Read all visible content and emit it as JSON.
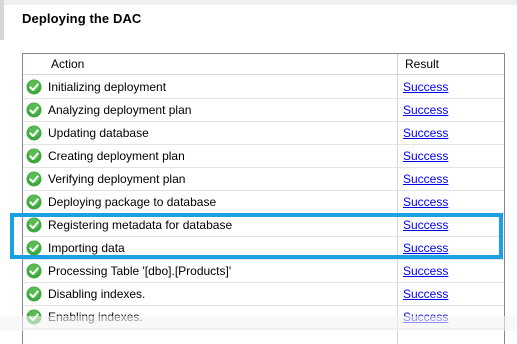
{
  "page": {
    "title": "Deploying the DAC"
  },
  "grid": {
    "headers": {
      "action": "Action",
      "result": "Result"
    },
    "rows": [
      {
        "action": "Initializing deployment",
        "result": "Success",
        "icon": "success-check-icon"
      },
      {
        "action": "Analyzing deployment plan",
        "result": "Success",
        "icon": "success-check-icon"
      },
      {
        "action": "Updating database",
        "result": "Success",
        "icon": "success-check-icon"
      },
      {
        "action": "Creating deployment plan",
        "result": "Success",
        "icon": "success-check-icon"
      },
      {
        "action": "Verifying deployment plan",
        "result": "Success",
        "icon": "success-check-icon"
      },
      {
        "action": "Deploying package to database",
        "result": "Success",
        "icon": "success-check-icon"
      },
      {
        "action": "Registering metadata for database",
        "result": "Success",
        "icon": "success-check-icon"
      },
      {
        "action": "Importing data",
        "result": "Success",
        "icon": "success-check-icon"
      },
      {
        "action": "Processing Table '[dbo].[Products]'",
        "result": "Success",
        "icon": "success-check-icon"
      },
      {
        "action": "Disabling indexes.",
        "result": "Success",
        "icon": "success-check-icon"
      },
      {
        "action": "Enabling indexes.",
        "result": "Success",
        "icon": "success-check-icon"
      }
    ]
  },
  "colors": {
    "highlight": "#1ba1e2",
    "link": "#0000ee",
    "success": "#3ea83e"
  }
}
